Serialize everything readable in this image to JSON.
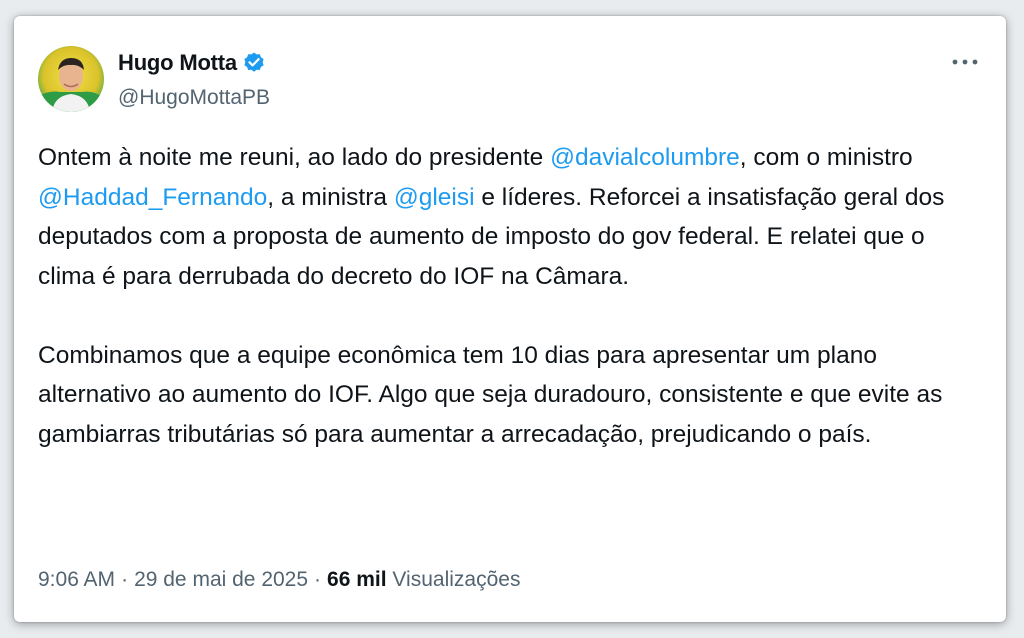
{
  "author": {
    "display_name": "Hugo Motta",
    "handle": "@HugoMottaPB",
    "verified_icon": "verified-badge-icon"
  },
  "tweet": {
    "paragraph1": [
      {
        "text": "Ontem à noite me reuni, ao lado do presidente ",
        "type": "text"
      },
      {
        "text": "@davialcolumbre",
        "type": "mention"
      },
      {
        "text": ", com o ministro ",
        "type": "text"
      },
      {
        "text": "@Haddad_Fernando",
        "type": "mention"
      },
      {
        "text": ", a ministra ",
        "type": "text"
      },
      {
        "text": "@gleisi",
        "type": "mention"
      },
      {
        "text": " e líderes. Reforcei a insatisfação geral dos deputados com a proposta de aumento de imposto do gov federal. E relatei que o clima é para derrubada do decreto do IOF na Câmara.",
        "type": "text"
      }
    ],
    "paragraph2": "Combinamos que a equipe econômica tem 10 dias para apresentar um plano alternativo ao aumento do IOF. Algo que seja duradouro, consistente e que evite as gambiarras tributárias só para aumentar a arrecadação, prejudicando o país."
  },
  "meta": {
    "time": "9:06 AM",
    "separator": "·",
    "date": "29 de mai de 2025",
    "views_count": "66 mil",
    "views_label": "Visualizações"
  },
  "colors": {
    "mention": "#1d9bf0",
    "verified": "#1d9bf0",
    "text": "#0f1419",
    "secondary": "#536471"
  },
  "icons": {
    "more": "more-options-icon"
  }
}
